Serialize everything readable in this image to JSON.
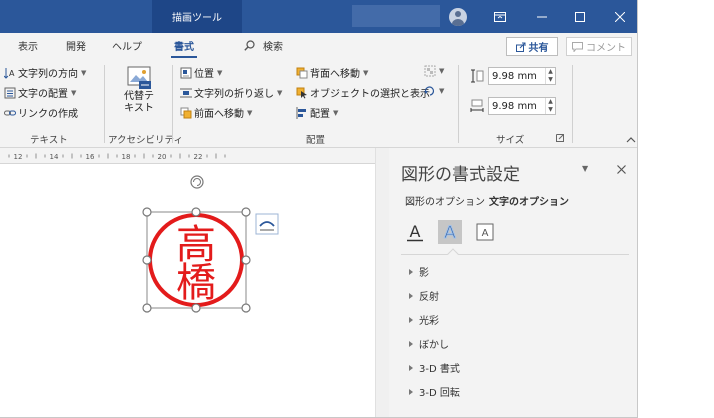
{
  "titlebar": {
    "context_tab": "描画ツール"
  },
  "menu": {
    "items": [
      "表示",
      "開発",
      "ヘルプ",
      "書式"
    ],
    "search_label": "検索",
    "share_label": "共有",
    "comment_label": "コメント"
  },
  "ribbon": {
    "text_group": {
      "direction": "文字列の方向",
      "align": "文字の配置",
      "link": "リンクの作成",
      "label": "テキスト"
    },
    "access_group": {
      "alt_line1": "代替テ",
      "alt_line2": "キスト",
      "label": "アクセシビリティ"
    },
    "arrange_group": {
      "position": "位置",
      "wrap": "文字列の折り返し",
      "forward": "前面へ移動",
      "backward": "背面へ移動",
      "selection": "オブジェクトの選択と表示",
      "align": "配置",
      "label": "配置"
    },
    "size_group": {
      "height": "9.98 mm",
      "width": "9.98 mm",
      "label": "サイズ"
    }
  },
  "ruler": {
    "ticks": [
      "12",
      "14",
      "16",
      "18",
      "20",
      "22"
    ]
  },
  "document": {
    "char1": "高",
    "char2": "橋"
  },
  "pane": {
    "title": "図形の書式設定",
    "tabs": [
      "図形のオプション",
      "文字のオプション"
    ],
    "sections": [
      "影",
      "反射",
      "光彩",
      "ぼかし",
      "3-D 書式",
      "3-D 回転"
    ]
  },
  "colors": {
    "accent": "#2b579a",
    "stamp_red": "#e31b1b"
  }
}
